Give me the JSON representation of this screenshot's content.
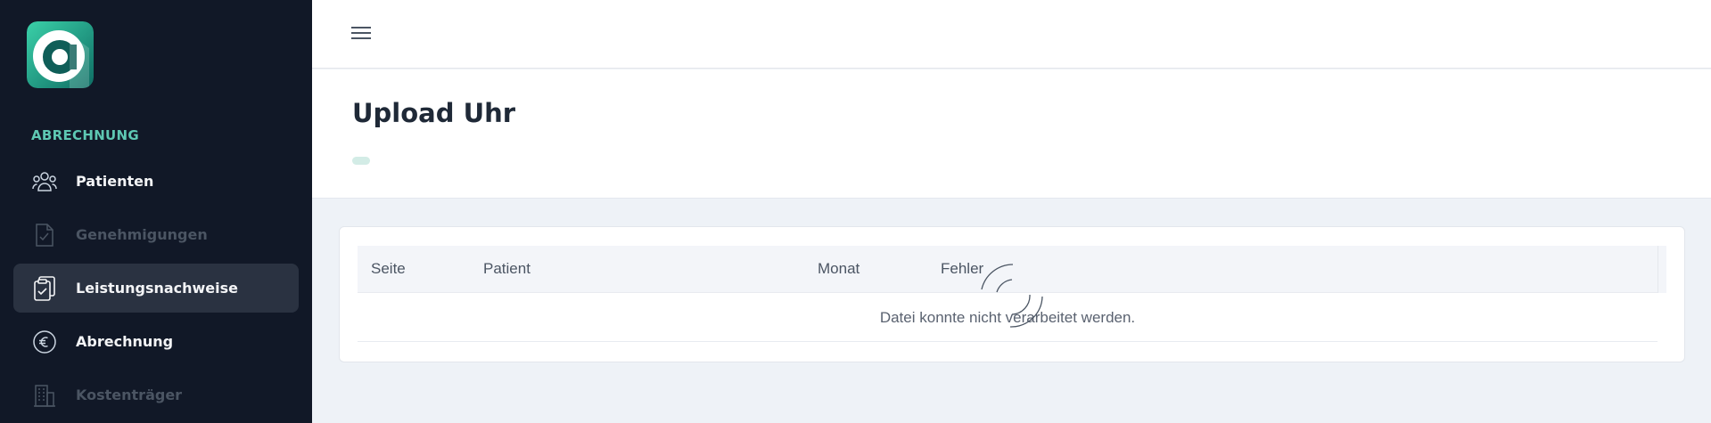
{
  "sidebar": {
    "section": "ABRECHNUNG",
    "items": [
      {
        "label": "Patienten",
        "icon": "users-icon",
        "state": "normal"
      },
      {
        "label": "Genehmigungen",
        "icon": "document-check-icon",
        "state": "disabled"
      },
      {
        "label": "Leistungsnachweise",
        "icon": "clipboard-check-icon",
        "state": "active"
      },
      {
        "label": "Abrechnung",
        "icon": "euro-icon",
        "state": "normal"
      },
      {
        "label": "Kostenträger",
        "icon": "building-icon",
        "state": "disabled"
      }
    ]
  },
  "header": {
    "title": "Upload Uhr"
  },
  "table": {
    "columns": [
      "Seite",
      "Patient",
      "Monat",
      "Fehler"
    ],
    "empty_message": "Datei konnte nicht verarbeitet werden."
  },
  "colors": {
    "sidebar_bg": "#111827",
    "accent": "#5ec8b3",
    "active_item_bg": "#2a3241"
  }
}
